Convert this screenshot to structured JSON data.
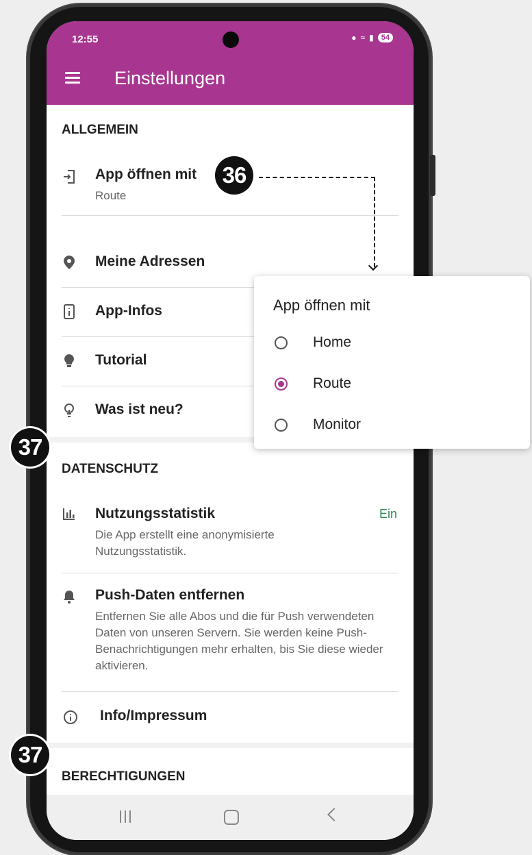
{
  "statusbar": {
    "time": "12:55",
    "battery": "54"
  },
  "appbar": {
    "title": "Einstellungen"
  },
  "sections": {
    "allgemein": {
      "title": "ALLGEMEIN",
      "items": [
        {
          "title": "App öffnen mit",
          "subtitle": "Route",
          "icon": "login-icon"
        },
        {
          "title": "Meine Adressen",
          "icon": "location-pin-icon"
        },
        {
          "title": "App-Infos",
          "icon": "info-box-icon"
        },
        {
          "title": "Tutorial",
          "icon": "lightbulb-icon"
        },
        {
          "title": "Was ist neu?",
          "icon": "bulb-outline-icon"
        }
      ]
    },
    "datenschutz": {
      "title": "DATENSCHUTZ",
      "items": [
        {
          "title": "Nutzungsstatistik",
          "subtitle": "Die App erstellt eine anonymisierte Nutzungsstatistik.",
          "value": "Ein",
          "icon": "bar-chart-icon"
        },
        {
          "title": "Push-Daten entfernen",
          "subtitle": "Entfernen Sie alle Abos und die für Push verwendeten Daten von unseren Servern. Sie werden keine Push-Benachrichtigungen mehr erhalten, bis Sie diese wieder aktivieren.",
          "icon": "bell-icon"
        },
        {
          "title": "Info/Impressum",
          "icon": "info-circle-icon"
        }
      ]
    },
    "berechtigungen": {
      "title": "BERECHTIGUNGEN"
    }
  },
  "dialog": {
    "title": "App öffnen mit",
    "options": [
      {
        "label": "Home",
        "selected": false
      },
      {
        "label": "Route",
        "selected": true
      },
      {
        "label": "Monitor",
        "selected": false
      }
    ]
  },
  "callouts": {
    "a": "36",
    "b": "37",
    "c": "37"
  },
  "colors": {
    "accent": "#a83690",
    "on_value": "#2e8b57"
  }
}
